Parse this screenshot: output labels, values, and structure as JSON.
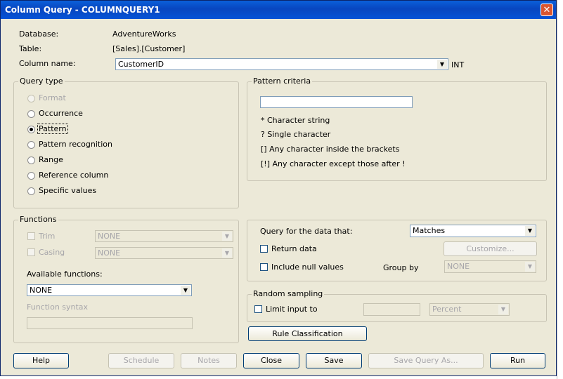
{
  "window": {
    "title": "Column Query - COLUMNQUERY1",
    "close_glyph": "✕"
  },
  "info": {
    "database_label": "Database:",
    "database_value": "AdventureWorks",
    "table_label": "Table:",
    "table_value": "[Sales].[Customer]",
    "column_label": "Column name:",
    "column_value": "CustomerID",
    "column_type": "INT"
  },
  "query_type": {
    "title": "Query type",
    "options": [
      "Format",
      "Occurrence",
      "Pattern",
      "Pattern recognition",
      "Range",
      "Reference column",
      "Specific values"
    ],
    "selected": "Pattern"
  },
  "pattern_criteria": {
    "title": "Pattern criteria",
    "value": "",
    "hints": [
      "* Character string",
      "? Single character",
      "[] Any character inside the brackets",
      "[!] Any character except those after !"
    ]
  },
  "functions": {
    "title": "Functions",
    "trim_label": "Trim",
    "trim_value": "NONE",
    "casing_label": "Casing",
    "casing_value": "NONE",
    "available_label": "Available functions:",
    "available_value": "NONE",
    "syntax_label": "Function syntax"
  },
  "query_for": {
    "label": "Query for the data that:",
    "value": "Matches",
    "return_data_label": "Return data",
    "customize_label": "Customize...",
    "include_null_label": "Include null values",
    "group_by_label": "Group by",
    "group_by_value": "NONE"
  },
  "random_sampling": {
    "title": "Random sampling",
    "limit_label": "Limit input to",
    "limit_value": "",
    "unit_value": "Percent"
  },
  "rule_classification_label": "Rule Classification",
  "buttons": {
    "help": "Help",
    "schedule": "Schedule",
    "notes": "Notes",
    "close": "Close",
    "save": "Save",
    "save_as": "Save Query As...",
    "run": "Run"
  }
}
